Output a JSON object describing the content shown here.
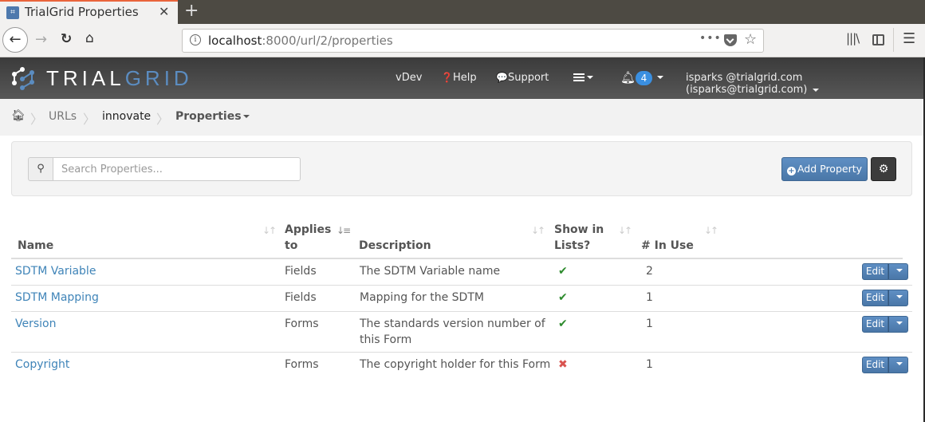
{
  "browser": {
    "tab_title": "TrialGrid Properties",
    "url_host": "localhost",
    "url_path": ":8000/url/2/properties"
  },
  "header": {
    "logo_part1": "TRIAL",
    "logo_part2": "GRID",
    "version": "vDev",
    "help": "Help",
    "support": "Support",
    "notification_count": "4",
    "user": "isparks @trialgrid.com (isparks@trialgrid.com)"
  },
  "breadcrumb": {
    "items": [
      "URLs",
      "innovate",
      "Properties"
    ],
    "separator": "〉"
  },
  "search": {
    "placeholder": "Search Properties...",
    "value": ""
  },
  "toolbar": {
    "add_label": "Add Property"
  },
  "table": {
    "columns": [
      {
        "line1": "",
        "line2": "Name"
      },
      {
        "line1": "Applies",
        "line2": "to"
      },
      {
        "line1": "",
        "line2": "Description"
      },
      {
        "line1": "Show in",
        "line2": "Lists?"
      },
      {
        "line1": "",
        "line2": "# In Use"
      }
    ],
    "rows": [
      {
        "name": "SDTM Variable",
        "applies_to": "Fields",
        "description_1": "The SDTM Variable name",
        "description_2": "",
        "show_in_lists": true,
        "show_icon": "✔",
        "in_use": "2",
        "edit_label": "Edit"
      },
      {
        "name": "SDTM Mapping",
        "applies_to": "Fields",
        "description_1": "Mapping for the SDTM",
        "description_2": "",
        "show_in_lists": true,
        "show_icon": "✔",
        "in_use": "1",
        "edit_label": "Edit"
      },
      {
        "name": "Version",
        "applies_to": "Forms",
        "description_1": "The standards version number of",
        "description_2": "this Form",
        "show_in_lists": true,
        "show_icon": "✔",
        "in_use": "1",
        "edit_label": "Edit"
      },
      {
        "name": "Copyright",
        "applies_to": "Forms",
        "description_1": "The copyright holder for this Form",
        "description_2": "",
        "show_in_lists": false,
        "show_icon": "✖",
        "in_use": "1",
        "edit_label": "Edit"
      }
    ]
  },
  "colors": {
    "accent": "#4a77a8",
    "link": "#3f84b8",
    "check": "#2e8b2e",
    "cross": "#d9534f",
    "badge": "#3a8fe0"
  }
}
